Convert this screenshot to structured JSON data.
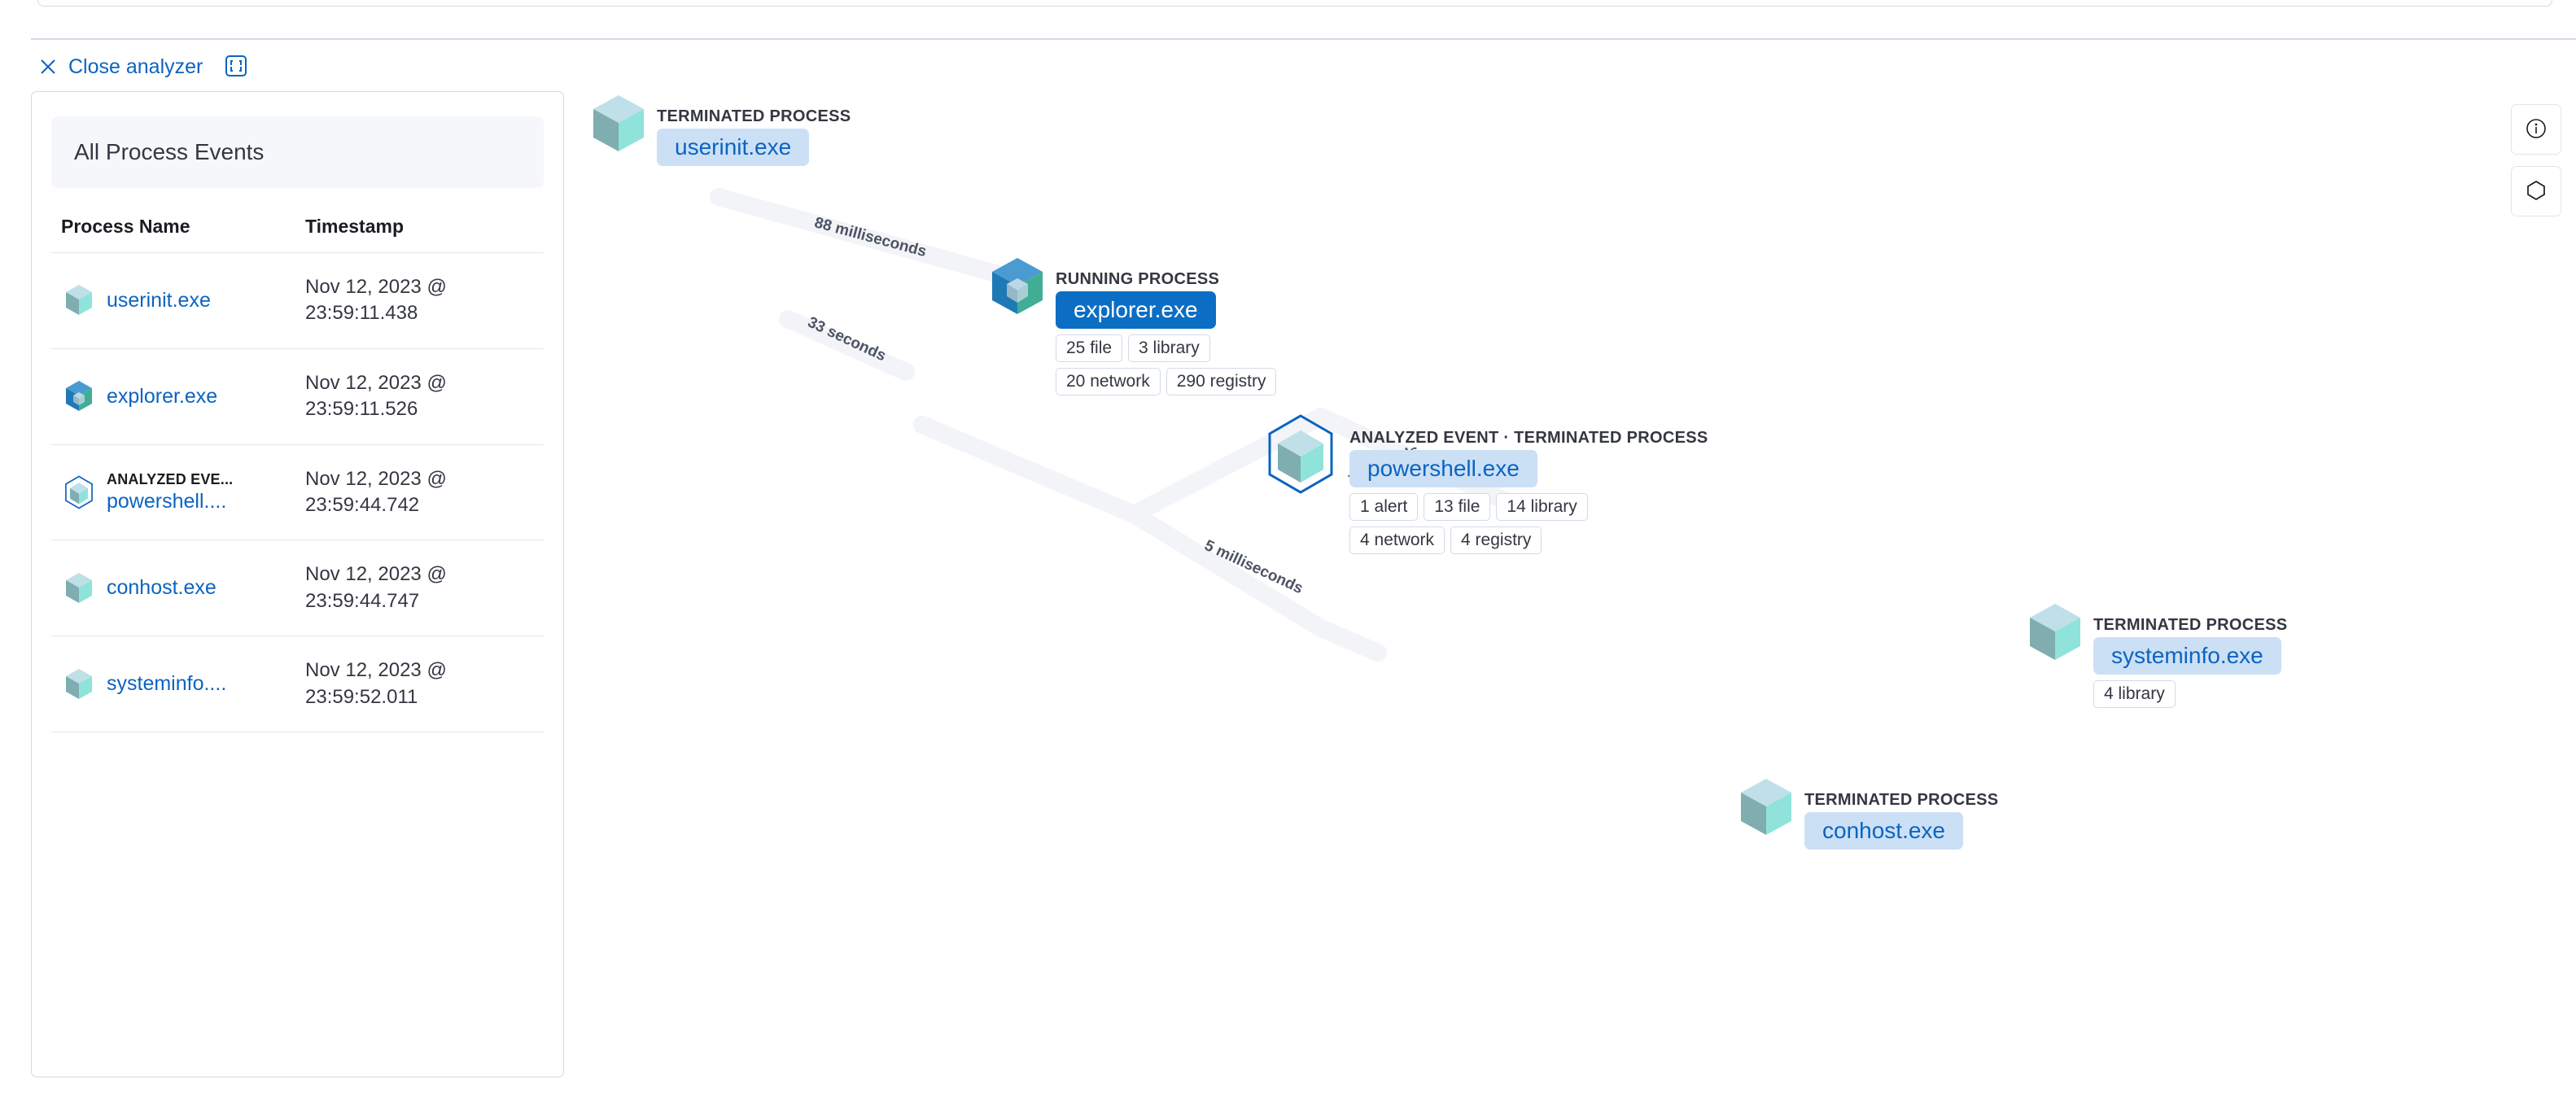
{
  "toolbar": {
    "close_analyzer_label": "Close analyzer",
    "close_icon": "close-icon",
    "fullscreen_icon": "fullscreen-icon"
  },
  "sidebar": {
    "title": "All Process Events",
    "columns": {
      "name": "Process Name",
      "timestamp": "Timestamp"
    },
    "rows": [
      {
        "eyebrow": "",
        "name": "userinit.exe",
        "date": "Nov 12, 2023 @",
        "time": "23:59:11.438",
        "icon": "process-cube-icon",
        "state": "terminated"
      },
      {
        "eyebrow": "",
        "name": "explorer.exe",
        "date": "Nov 12, 2023 @",
        "time": "23:59:11.526",
        "icon": "process-cube-icon",
        "state": "running"
      },
      {
        "eyebrow": "ANALYZED EVE...",
        "name": "powershell....",
        "date": "Nov 12, 2023 @",
        "time": "23:59:44.742",
        "icon": "analyzed-event-cube-icon",
        "state": "analyzed"
      },
      {
        "eyebrow": "",
        "name": "conhost.exe",
        "date": "Nov 12, 2023 @",
        "time": "23:59:44.747",
        "icon": "process-cube-icon",
        "state": "terminated"
      },
      {
        "eyebrow": "",
        "name": "systeminfo....",
        "date": "Nov 12, 2023 @",
        "time": "23:59:52.011",
        "icon": "process-cube-icon",
        "state": "terminated"
      }
    ]
  },
  "graph": {
    "nodes": [
      {
        "id": "userinit",
        "eyebrow": "TERMINATED PROCESS",
        "label": "userinit.exe",
        "state": "terminated",
        "badges": []
      },
      {
        "id": "explorer",
        "eyebrow": "RUNNING PROCESS",
        "label": "explorer.exe",
        "state": "running",
        "badges": [
          "25 file",
          "3 library",
          "20 network",
          "290 registry"
        ]
      },
      {
        "id": "powershell",
        "eyebrow": "ANALYZED EVENT · TERMINATED PROCESS",
        "label": "powershell.exe",
        "state": "analyzed",
        "badges": [
          "1 alert",
          "13 file",
          "14 library",
          "4 network",
          "4 registry"
        ]
      },
      {
        "id": "systeminfo",
        "eyebrow": "TERMINATED PROCESS",
        "label": "systeminfo.exe",
        "state": "terminated",
        "badges": [
          "4 library"
        ]
      },
      {
        "id": "conhost",
        "eyebrow": "TERMINATED PROCESS",
        "label": "conhost.exe",
        "state": "terminated",
        "badges": []
      }
    ],
    "edges": [
      {
        "from": "userinit",
        "to": "explorer",
        "label": "88 milliseconds"
      },
      {
        "from": "explorer",
        "to": "powershell",
        "label": "33 seconds"
      },
      {
        "from": "powershell",
        "to": "systeminfo",
        "label": "7 seconds"
      },
      {
        "from": "powershell",
        "to": "conhost",
        "label": "5 milliseconds"
      }
    ]
  },
  "controls": {
    "info_icon": "info-icon",
    "legend_icon": "hexagon-icon"
  },
  "colors": {
    "link": "#0b64c1",
    "running_pill": "#0b6ec4",
    "terminated_pill": "#cce0f5",
    "analyzed_outline": "#0b64c1",
    "edge": "#f2f4f8",
    "border": "#d3dae6"
  }
}
